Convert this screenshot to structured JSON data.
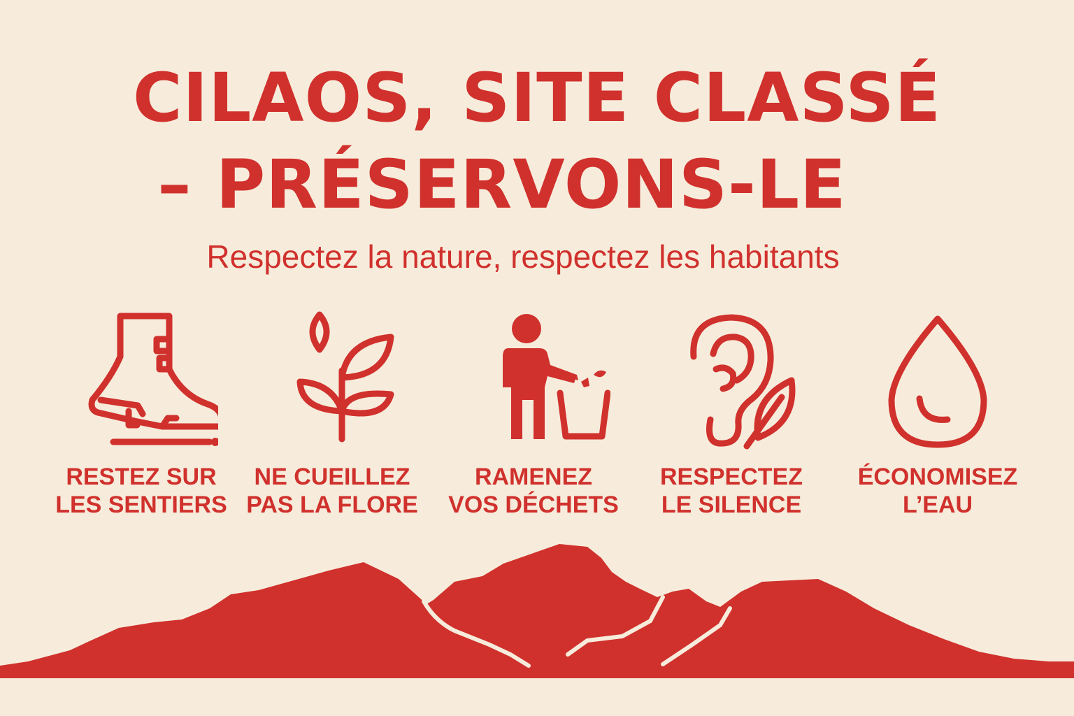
{
  "poster": {
    "title_line1": "CILAOS, SITE CLASSÉ",
    "title_line2": "– PRÉSERVONS-LE",
    "subtitle": "Respectez la nature, respectez les habitants",
    "accent_color": "#d0312d",
    "background_color": "#f7ecdc"
  },
  "rules": [
    {
      "icon": "hiking-boot-icon",
      "line1": "RESTEZ SUR",
      "line2": "LES SENTIERS"
    },
    {
      "icon": "plant-sprout-icon",
      "line1": "NE CUEILLEZ",
      "line2": "PAS LA FLORE"
    },
    {
      "icon": "person-trash-bin-icon",
      "line1": "RAMENEZ",
      "line2": "VOS DÉCHETS"
    },
    {
      "icon": "ear-leaf-icon",
      "line1": "RESPECTEZ",
      "line2": "LE SILENCE"
    },
    {
      "icon": "water-drop-icon",
      "line1": "ÉCONOMISEZ",
      "line2": "L’EAU"
    }
  ]
}
